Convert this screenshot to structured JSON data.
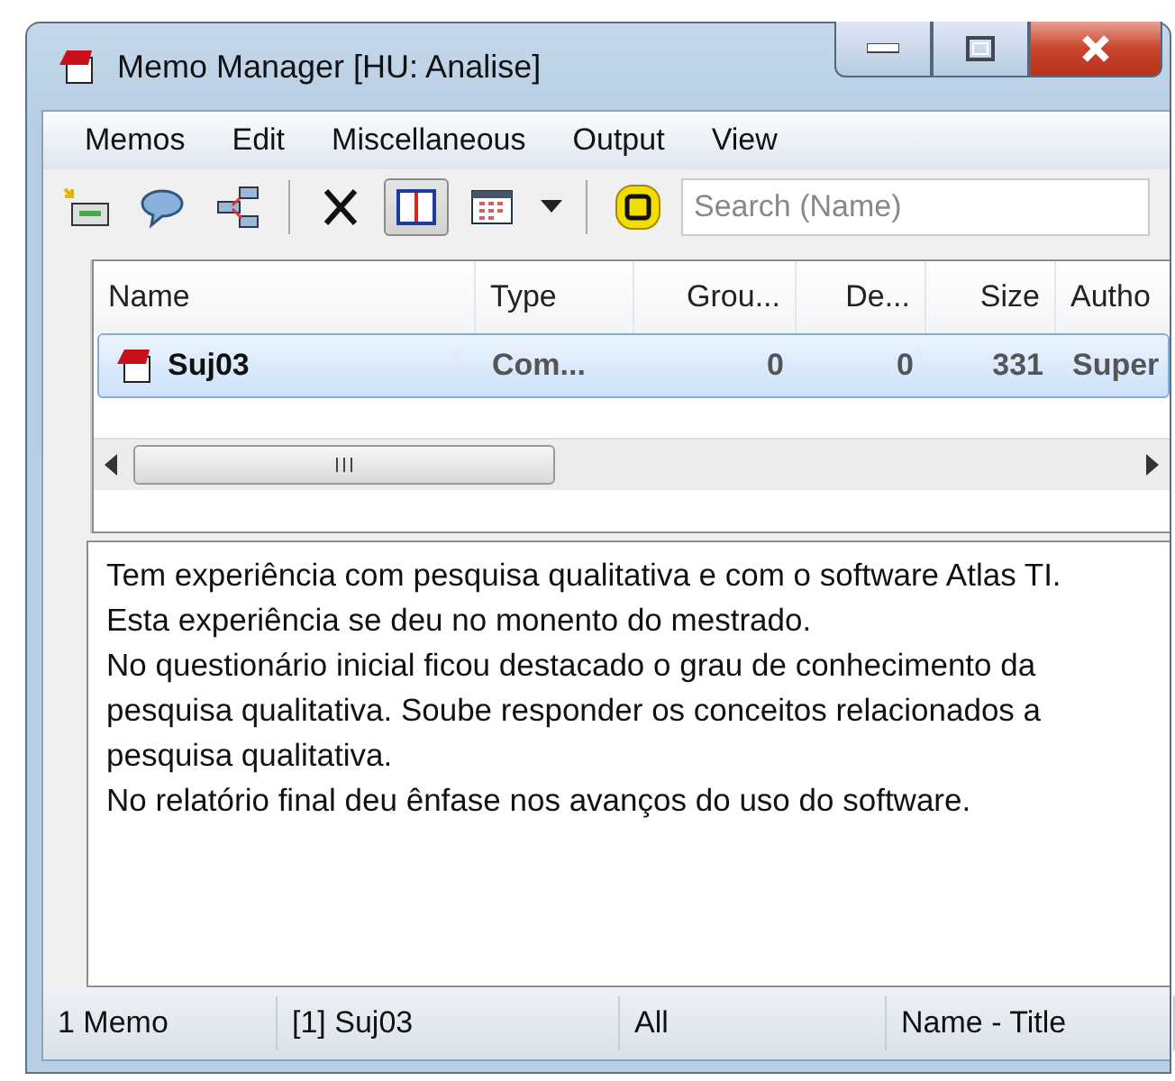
{
  "window": {
    "title": "Memo Manager [HU: Analise]"
  },
  "menu": [
    "Memos",
    "Edit",
    "Miscellaneous",
    "Output",
    "View"
  ],
  "toolbar": [
    {
      "kind": "new",
      "selected": false
    },
    {
      "kind": "comment",
      "selected": false
    },
    {
      "kind": "tree",
      "selected": false
    },
    {
      "kind": "sep"
    },
    {
      "kind": "delete",
      "selected": false
    },
    {
      "kind": "split",
      "selected": true
    },
    {
      "kind": "calendar",
      "selected": false
    },
    {
      "kind": "dropdown",
      "selected": false
    },
    {
      "kind": "sep"
    },
    {
      "kind": "filter",
      "selected": false
    }
  ],
  "search": {
    "placeholder": "Search (Name)"
  },
  "table": {
    "columns": [
      {
        "label": "Name"
      },
      {
        "label": "Type"
      },
      {
        "label": "Grou..."
      },
      {
        "label": "De..."
      },
      {
        "label": "Size"
      },
      {
        "label": "Autho"
      }
    ],
    "rows": [
      {
        "selected": true,
        "cells": [
          "Suj03",
          "Com...",
          "0",
          "0",
          "331",
          "Super"
        ]
      }
    ]
  },
  "memo_text": [
    "Tem experiência com pesquisa qualitativa e com o software Atlas TI.",
    "Esta experiência se deu no monento do mestrado.",
    "No questionário inicial ficou destacado o grau de conhecimento da pesquisa qualitativa. Soube responder os conceitos relacionados a pesquisa qualitativa.",
    "No relatório final deu ênfase nos avanços do uso do software."
  ],
  "status_bar": [
    "1 Memo",
    "[1] Suj03",
    "All",
    "Name - Title"
  ]
}
